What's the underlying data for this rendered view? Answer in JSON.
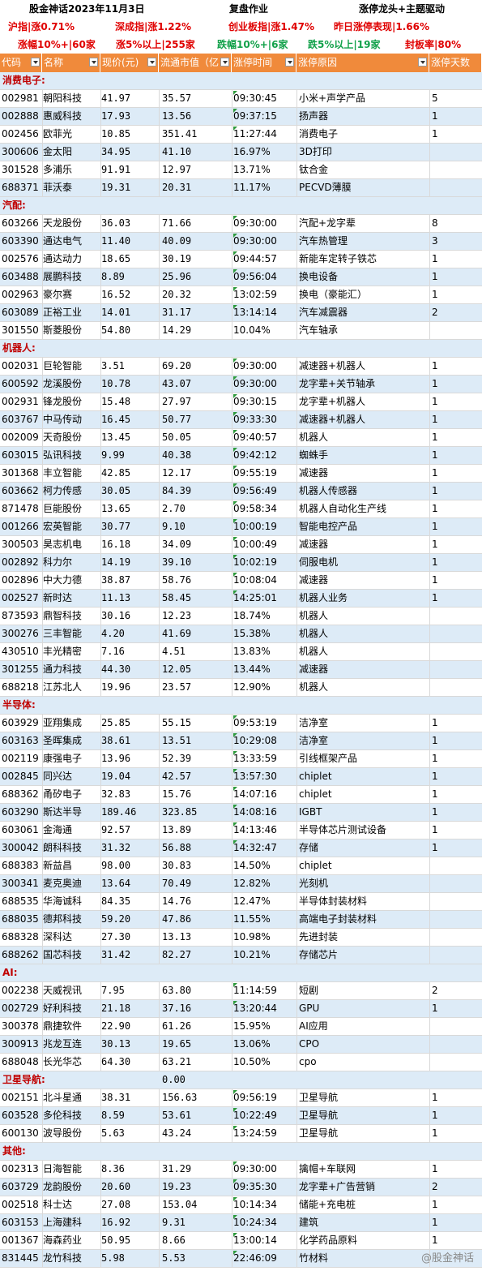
{
  "header": {
    "title": "股金神话2023年11月3日",
    "subtitle": "复盘作业",
    "theme": "涨停龙头+主题驱动"
  },
  "indices": [
    {
      "text": "沪指|涨0.71%"
    },
    {
      "text": "深成指|涨1.22%"
    },
    {
      "text": "创业板指|涨1.47%"
    },
    {
      "text": "昨日涨停表现|1.66%"
    }
  ],
  "stats": [
    {
      "text": "涨幅10%+|60家",
      "color": "red"
    },
    {
      "text": "涨5%以上|255家",
      "color": "red"
    },
    {
      "text": "跌幅10%+|6家",
      "color": "green"
    },
    {
      "text": "跌5%以上|19家",
      "color": "green"
    },
    {
      "text": "封板率|80%",
      "color": "red"
    }
  ],
  "columns": [
    "代码",
    "名称",
    "现价(元)",
    "流通市值（亿",
    "涨停时间",
    "涨停原因",
    "涨停天数"
  ],
  "sections": [
    {
      "name": "消费电子:",
      "rows": [
        [
          "002981",
          "朝阳科技",
          "41.97",
          "35.57",
          "09:30:45",
          "小米+声学产品",
          "5"
        ],
        [
          "002888",
          "惠威科技",
          "17.93",
          "13.56",
          "09:37:15",
          "扬声器",
          "1"
        ],
        [
          "002456",
          "欧菲光",
          "10.85",
          "351.41",
          "11:27:44",
          "消费电子",
          "1"
        ],
        [
          "300606",
          "金太阳",
          "34.95",
          "41.10",
          "16.97%",
          "3D打印",
          ""
        ],
        [
          "301528",
          "多浦乐",
          "91.91",
          "12.97",
          "13.71%",
          "钛合金",
          ""
        ],
        [
          "688371",
          "菲沃泰",
          "19.31",
          "20.31",
          "11.17%",
          "PECVD薄膜",
          ""
        ]
      ]
    },
    {
      "name": "汽配:",
      "rows": [
        [
          "603266",
          "天龙股份",
          "36.03",
          "71.66",
          "09:30:00",
          "汽配+龙字辈",
          "8"
        ],
        [
          "603390",
          "通达电气",
          "11.40",
          "40.09",
          "09:30:00",
          "汽车热管理",
          "3"
        ],
        [
          "002576",
          "通达动力",
          "18.65",
          "30.19",
          "09:44:57",
          "新能车定转子铁芯",
          "1"
        ],
        [
          "603488",
          "展鹏科技",
          "8.89",
          "25.96",
          "09:56:04",
          "换电设备",
          "1"
        ],
        [
          "002963",
          "豪尔赛",
          "16.52",
          "20.32",
          "13:02:59",
          "换电（豪能汇）",
          "1"
        ],
        [
          "603089",
          "正裕工业",
          "14.01",
          "31.17",
          "13:14:14",
          "汽车减震器",
          "2"
        ],
        [
          "301550",
          "斯菱股份",
          "54.80",
          "14.29",
          "10.04%",
          "汽车轴承",
          ""
        ]
      ]
    },
    {
      "name": "机器人:",
      "rows": [
        [
          "002031",
          "巨轮智能",
          "3.51",
          "69.20",
          "09:30:00",
          "减速器+机器人",
          "1"
        ],
        [
          "600592",
          "龙溪股份",
          "10.78",
          "43.07",
          "09:30:00",
          "龙字辈+关节轴承",
          "1"
        ],
        [
          "002931",
          "锋龙股份",
          "15.48",
          "27.97",
          "09:30:15",
          "龙字辈+机器人",
          "1"
        ],
        [
          "603767",
          "中马传动",
          "16.45",
          "50.77",
          "09:33:30",
          "减速器+机器人",
          "1"
        ],
        [
          "002009",
          "天奇股份",
          "13.45",
          "50.05",
          "09:40:57",
          "机器人",
          "1"
        ],
        [
          "603015",
          "弘讯科技",
          "9.99",
          "40.38",
          "09:42:12",
          "蜘蛛手",
          "1"
        ],
        [
          "301368",
          "丰立智能",
          "42.85",
          "12.17",
          "09:55:19",
          "减速器",
          "1"
        ],
        [
          "603662",
          "柯力传感",
          "30.05",
          "84.39",
          "09:56:49",
          "机器人传感器",
          "1"
        ],
        [
          "871478",
          "巨能股份",
          "13.65",
          "2.70",
          "09:58:34",
          "机器人自动化生产线",
          "1"
        ],
        [
          "001266",
          "宏英智能",
          "30.77",
          "9.10",
          "10:00:19",
          "智能电控产品",
          "1"
        ],
        [
          "300503",
          "昊志机电",
          "16.18",
          "34.09",
          "10:00:49",
          "减速器",
          "1"
        ],
        [
          "002892",
          "科力尔",
          "14.19",
          "39.10",
          "10:02:19",
          "伺服电机",
          "1"
        ],
        [
          "002896",
          "中大力德",
          "38.87",
          "58.76",
          "10:08:04",
          "减速器",
          "1"
        ],
        [
          "002527",
          "新时达",
          "11.13",
          "58.45",
          "14:25:01",
          "机器人业务",
          "1"
        ],
        [
          "873593",
          "鼎智科技",
          "30.16",
          "12.23",
          "18.74%",
          "机器人",
          ""
        ],
        [
          "300276",
          "三丰智能",
          "4.20",
          "41.69",
          "15.38%",
          "机器人",
          ""
        ],
        [
          "430510",
          "丰光精密",
          "7.16",
          "4.51",
          "13.83%",
          "机器人",
          ""
        ],
        [
          "301255",
          "通力科技",
          "44.30",
          "12.05",
          "13.44%",
          "减速器",
          ""
        ],
        [
          "688218",
          "江苏北人",
          "19.96",
          "23.57",
          "12.90%",
          "机器人",
          ""
        ]
      ]
    },
    {
      "name": "半导体:",
      "rows": [
        [
          "603929",
          "亚翔集成",
          "25.85",
          "55.15",
          "09:53:19",
          "洁净室",
          "1"
        ],
        [
          "603163",
          "圣晖集成",
          "38.61",
          "13.51",
          "10:29:08",
          "洁净室",
          "1"
        ],
        [
          "002119",
          "康强电子",
          "13.96",
          "52.39",
          "13:33:59",
          "引线框架产品",
          "1"
        ],
        [
          "002845",
          "同兴达",
          "19.04",
          "42.57",
          "13:57:30",
          "chiplet",
          "1"
        ],
        [
          "688362",
          "甬矽电子",
          "32.83",
          "15.76",
          "14:07:16",
          "chiplet",
          "1"
        ],
        [
          "603290",
          "斯达半导",
          "189.46",
          "323.85",
          "14:08:16",
          "IGBT",
          "1"
        ],
        [
          "603061",
          "金海通",
          "92.57",
          "13.89",
          "14:13:46",
          "半导体芯片测试设备",
          "1"
        ],
        [
          "300042",
          "朗科科技",
          "31.32",
          "56.88",
          "14:32:47",
          "存储",
          "1"
        ],
        [
          "688383",
          "新益昌",
          "98.00",
          "30.83",
          "14.50%",
          "chiplet",
          ""
        ],
        [
          "300341",
          "麦克奥迪",
          "13.64",
          "70.49",
          "12.82%",
          "光刻机",
          ""
        ],
        [
          "688535",
          "华海诚科",
          "84.35",
          "14.76",
          "12.47%",
          "半导体封装材料",
          ""
        ],
        [
          "688035",
          "德邦科技",
          "59.20",
          "47.86",
          "11.55%",
          "高端电子封装材料",
          ""
        ],
        [
          "688328",
          "深科达",
          "27.30",
          "13.13",
          "10.98%",
          "先进封装",
          ""
        ],
        [
          "688262",
          "国芯科技",
          "31.42",
          "82.27",
          "10.21%",
          "存储芯片",
          ""
        ]
      ]
    },
    {
      "name": "AI:",
      "rows": [
        [
          "002238",
          "天威视讯",
          "7.95",
          "63.80",
          "11:14:59",
          "短剧",
          "2"
        ],
        [
          "002729",
          "好利科技",
          "21.18",
          "37.16",
          "13:20:44",
          "GPU",
          "1"
        ],
        [
          "300378",
          "鼎捷软件",
          "22.90",
          "61.26",
          "15.95%",
          "AI应用",
          ""
        ],
        [
          "300913",
          "兆龙互连",
          "30.13",
          "19.65",
          "13.06%",
          "CPO",
          ""
        ],
        [
          "688048",
          "长光华芯",
          "64.30",
          "63.21",
          "10.50%",
          "cpo",
          ""
        ]
      ]
    },
    {
      "name": "卫星导航:",
      "value3": "0.00",
      "rows": [
        [
          "002151",
          "北斗星通",
          "38.31",
          "156.63",
          "09:56:19",
          "卫星导航",
          "1"
        ],
        [
          "603528",
          "多伦科技",
          "8.59",
          "53.61",
          "10:22:49",
          "卫星导航",
          "1"
        ],
        [
          "600130",
          "波导股份",
          "5.63",
          "43.24",
          "13:24:59",
          "卫星导航",
          "1"
        ]
      ]
    },
    {
      "name": "其他:",
      "rows": [
        [
          "002313",
          "日海智能",
          "8.36",
          "31.29",
          "09:30:00",
          "擒帽+车联网",
          "1"
        ],
        [
          "603729",
          "龙韵股份",
          "20.60",
          "19.23",
          "09:35:30",
          "龙字辈+广告营销",
          "2"
        ],
        [
          "002518",
          "科士达",
          "27.08",
          "153.04",
          "10:14:34",
          "储能+充电桩",
          "1"
        ],
        [
          "603153",
          "上海建科",
          "16.92",
          "9.31",
          "10:24:34",
          "建筑",
          "1"
        ],
        [
          "001367",
          "海森药业",
          "50.95",
          "8.66",
          "13:00:14",
          "化学药品原料",
          "1"
        ],
        [
          "831445",
          "龙竹科技",
          "5.98",
          "5.53",
          "22:46:09",
          "竹材料",
          ""
        ]
      ]
    }
  ],
  "watermark": "@股金神话"
}
